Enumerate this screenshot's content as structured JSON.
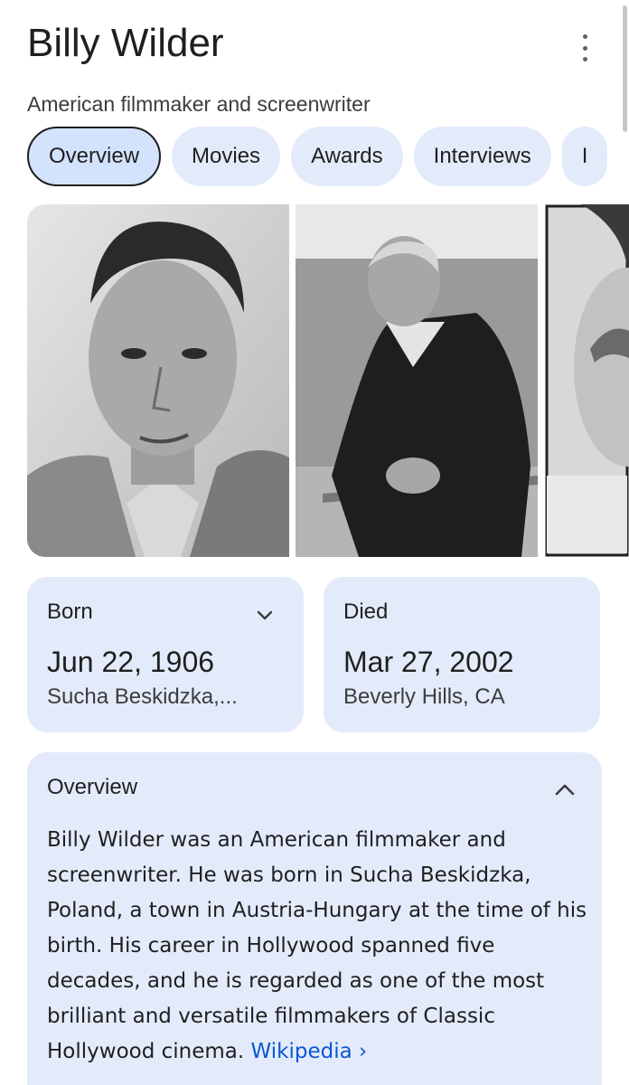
{
  "header": {
    "title": "Billy Wilder",
    "subtitle": "American filmmaker and screenwriter"
  },
  "tabs": [
    {
      "label": "Overview",
      "active": true
    },
    {
      "label": "Movies"
    },
    {
      "label": "Awards"
    },
    {
      "label": "Interviews"
    },
    {
      "label": "I"
    }
  ],
  "born": {
    "label": "Born",
    "date": "Jun 22, 1906",
    "place": "Sucha Beskidzka,..."
  },
  "died": {
    "label": "Died",
    "date": "Mar 27, 2002",
    "place": "Beverly Hills, CA"
  },
  "overview": {
    "label": "Overview",
    "text": "Billy Wilder was an American filmmaker and screenwriter. He was born in Sucha Beskidzka, Poland, a town in Austria-Hungary at the time of his birth. His career in Hollywood spanned five decades, and he is regarded as one of the most brilliant and versatile filmmakers of Classic Hollywood cinema.",
    "source_link": "Wikipedia",
    "source_chevron": "›"
  },
  "icons": {
    "more": "more-vert-icon",
    "expand": "chevron-down-icon",
    "collapse": "chevron-up-icon"
  },
  "colors": {
    "card_bg": "#e3ebfb",
    "active_tab_bg": "#d3e3fd",
    "link": "#0b57d0"
  }
}
